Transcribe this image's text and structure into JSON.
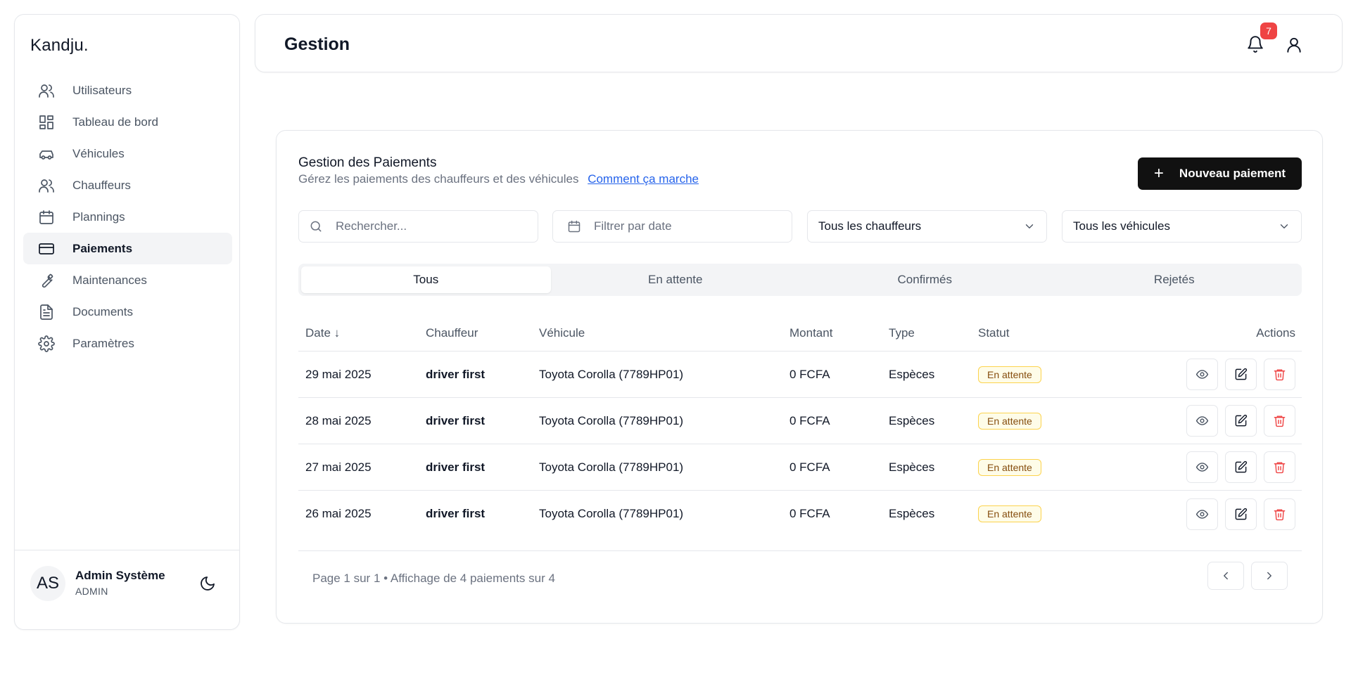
{
  "brand": "Kandju.",
  "sidebar": {
    "items": [
      {
        "label": "Utilisateurs",
        "icon": "users-icon"
      },
      {
        "label": "Tableau de bord",
        "icon": "dashboard-icon"
      },
      {
        "label": "Véhicules",
        "icon": "car-icon"
      },
      {
        "label": "Chauffeurs",
        "icon": "users-icon"
      },
      {
        "label": "Plannings",
        "icon": "calendar-icon"
      },
      {
        "label": "Paiements",
        "icon": "credit-card-icon",
        "active": true
      },
      {
        "label": "Maintenances",
        "icon": "wrench-icon"
      },
      {
        "label": "Documents",
        "icon": "document-icon"
      },
      {
        "label": "Paramètres",
        "icon": "gear-icon"
      }
    ],
    "user": {
      "initials": "AS",
      "name": "Admin Système",
      "role": "ADMIN"
    }
  },
  "header": {
    "title": "Gestion",
    "notification_count": "7"
  },
  "card": {
    "title": "Gestion des Paiements",
    "subtitle": "Gérez les paiements des chauffeurs et des véhicules",
    "help_link": "Comment ça marche",
    "new_button": "Nouveau paiement"
  },
  "filters": {
    "search_placeholder": "Rechercher...",
    "date_placeholder": "Filtrer par date",
    "driver_select": "Tous les chauffeurs",
    "vehicle_select": "Tous les véhicules"
  },
  "tabs": [
    "Tous",
    "En attente",
    "Confirmés",
    "Rejetés"
  ],
  "table": {
    "headers": {
      "date": "Date ↓",
      "driver": "Chauffeur",
      "vehicle": "Véhicule",
      "amount": "Montant",
      "type": "Type",
      "status": "Statut",
      "actions": "Actions"
    },
    "rows": [
      {
        "date": "29 mai 2025",
        "driver": "driver first",
        "vehicle": "Toyota Corolla (7789HP01)",
        "amount": "0 FCFA",
        "type": "Espèces",
        "status": "En attente"
      },
      {
        "date": "28 mai 2025",
        "driver": "driver first",
        "vehicle": "Toyota Corolla (7789HP01)",
        "amount": "0 FCFA",
        "type": "Espèces",
        "status": "En attente"
      },
      {
        "date": "27 mai 2025",
        "driver": "driver first",
        "vehicle": "Toyota Corolla (7789HP01)",
        "amount": "0 FCFA",
        "type": "Espèces",
        "status": "En attente"
      },
      {
        "date": "26 mai 2025",
        "driver": "driver first",
        "vehicle": "Toyota Corolla (7789HP01)",
        "amount": "0 FCFA",
        "type": "Espèces",
        "status": "En attente"
      }
    ]
  },
  "pagination": {
    "info": "Page 1 sur 1 • Affichage de 4 paiements sur 4"
  },
  "colors": {
    "primary": "#111111",
    "accent_link": "#2563eb",
    "danger": "#ef4444",
    "pending_badge_bg": "#fefce8",
    "pending_badge_border": "#fcd34d"
  }
}
